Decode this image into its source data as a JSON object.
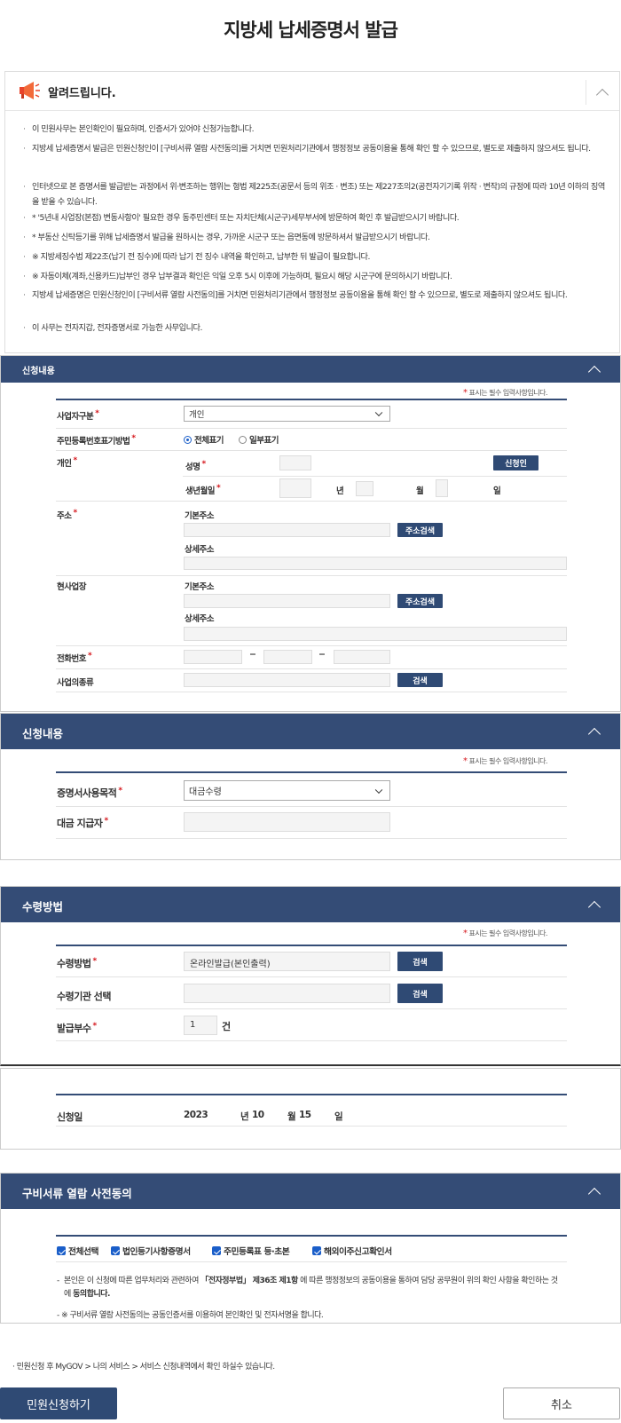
{
  "page_title": "지방세 납세증명서 발급",
  "notice": {
    "title": "알려드립니다.",
    "items": [
      "이 민원사무는 본인확인이 필요하며, 인증서가 있어야 신청가능합니다.",
      "지방세 납세증명서 발급은 민원신청인이 [구비서류 열람 사전동의]를 거치면 민원처리기관에서 행정정보 공동이용을 통해 확인 할 수 있으므로, 별도로 제출하지 않으셔도 됩니다.",
      "인터넷으로 본 증명서를 발급받는 과정에서 위·변조하는 행위는 형법 제225조(공문서 등의 위조 · 변조) 또는 제227조의2(공전자기기록 위작 · 변작)의 규정에 따라 10년 이하의 징역을 받을 수 있습니다.",
      " * '5년내 사업장(본점) 변동사항이' 필요한 경우 동주민센터 또는 자치단체(시군구)세무부서에 방문하여 확인 후 발급받으시기 바랍니다.",
      " * 부동산 신탁등기를 위해 납세증명서 발급을 원하시는 경우, 가까운 시군구 또는 읍면동에 방문하셔서 발급받으시기 바랍니다.",
      "※ 지방세징수법 제22조(납기 전 징수)에 따라 납기 전 징수 내역을 확인하고, 납부한 뒤 발급이 필요합니다.",
      "※ 자동이체(계좌,신용카드)납부인 경우 납부결과 확인은 익일 오후 5시 이후에 가능하며, 필요시 해당 시군구에 문의하시기 바랍니다.",
      "지방세 납세증명은 민원신청인이 [구비서류 열람 사전동의]를 거치면 민원처리기관에서 행정정보 공동이용을 통해 확인 할 수 있으므로, 별도로 제출하지 않으셔도 됩니다.",
      "이 사무는 전자지갑, 전자증명서로 가능한 사무입니다."
    ]
  },
  "required_note": "표시는 필수 입력사항입니다.",
  "section1": {
    "title": "신청내용",
    "business_type_label": "사업자구분",
    "business_type_value": "개인",
    "rrn_method_label": "주민등록번호표기방법",
    "rrn_full": "전체표기",
    "rrn_partial": "일부표기",
    "individual_label": "개인",
    "name_label": "성명",
    "applicant_button": "신청인",
    "birth_label": "생년월일",
    "year": "년",
    "month": "월",
    "day": "일",
    "address_label": "주소",
    "basic_address": "기본주소",
    "detail_address": "상세주소",
    "address_search": "주소검색",
    "workplace_label": "현사업장",
    "phone_label": "전화번호",
    "dash": "−",
    "business_kind_label": "사업의종류",
    "search": "검색"
  },
  "section2": {
    "title": "신청내용",
    "purpose_label": "증명서사용목적",
    "purpose_value": "대금수령",
    "payer_label": "대금 지급자"
  },
  "section3": {
    "title": "수령방법",
    "method_label": "수령방법",
    "method_value": "온라인발급(본인출력)",
    "agency_label": "수령기관 선택",
    "search": "검색",
    "copies_label": "발급부수",
    "copies_value": "1",
    "copies_unit": "건"
  },
  "application_date": {
    "label": "신청일",
    "year": "2023",
    "year_unit": "년",
    "month": "10",
    "month_unit": "월",
    "day": "15",
    "day_unit": "일"
  },
  "consent": {
    "title": "구비서류 열람 사전동의",
    "checkboxes": [
      "전체선택",
      "법인등기사항증명서",
      "주민등록표 등·초본",
      "해외이주신고확인서"
    ],
    "text1_a": "본인은 이 신청에 따른 업무처리와 관련하여 ",
    "text1_b": "「전자정부법」 제36조 제1항",
    "text1_c": " 에 따른 행정정보의 공동이용을 통하여 담당 공무원이 위의 확인 사항을 확인하는 것에 ",
    "text1_d": "동의합니다.",
    "text2": "※ 구비서류 열람 사전동의는 공동인증서를 이용하여 본인확인 및 전자서명을 합니다."
  },
  "footer_note": "민원신청 후 MyGOV > 나의 서비스 > 서비스 신청내역에서 확인 하실수 있습니다.",
  "submit_button": "민원신청하기",
  "cancel_button": "취소",
  "colors": {
    "header": "#344c76",
    "button": "#2f4a74",
    "required": "#d5151b",
    "check": "#1a5ec9"
  }
}
